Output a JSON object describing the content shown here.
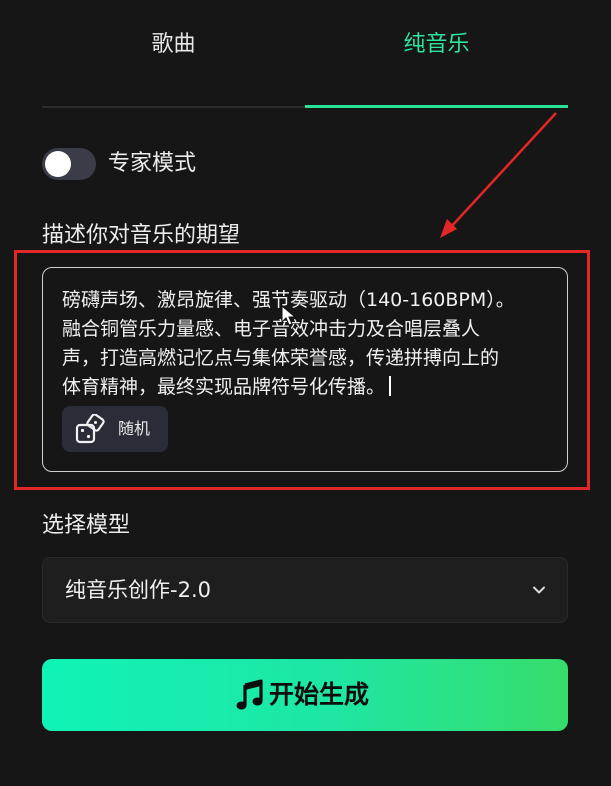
{
  "tabs": {
    "song": "歌曲",
    "pure_music": "纯音乐",
    "active": "pure_music"
  },
  "expert_mode": {
    "label": "专家模式",
    "enabled": false
  },
  "prompt": {
    "label": "描述你对音乐的期望",
    "lines": [
      "磅礴声场、激昂旋律、强节奏驱动（140-160BPM）。",
      "融合铜管乐力量感、电子音效冲击力及合唱层叠人",
      "声，打造高燃记忆点与集体荣誉感，传递拼搏向上的",
      "体育精神，最终实现品牌符号化传播。"
    ],
    "random_button": "随机"
  },
  "model": {
    "label": "选择模型",
    "selected": "纯音乐创作-2.0"
  },
  "generate_button": "开始生成",
  "colors": {
    "accent": "#27e39a",
    "background": "#161616",
    "annotation": "#e32626",
    "button_gradient_start": "#10f3b7",
    "button_gradient_end": "#37dd6a"
  },
  "icons": {
    "random": "dice-icon",
    "model_dropdown": "chevron-down-icon",
    "generate": "music-note-icon"
  }
}
